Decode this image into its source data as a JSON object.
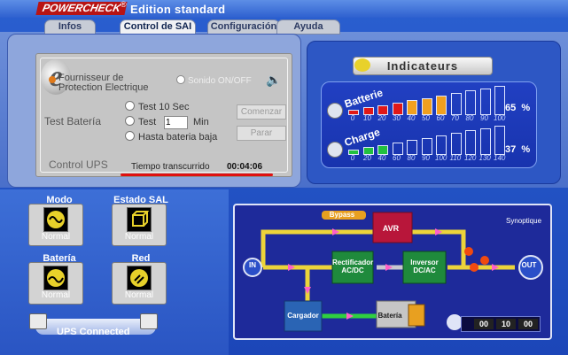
{
  "app": {
    "logo": "POWERCHECK",
    "reg": "®",
    "edition": "Edition standard"
  },
  "tabs": [
    {
      "label": "Infos"
    },
    {
      "label": "Control de SAI"
    },
    {
      "label": "Configuración"
    },
    {
      "label": "Ayuda"
    }
  ],
  "control": {
    "provider": "Fournisseur de Protection Electrique",
    "sonido": "Sonido ON/OFF",
    "test_heading": "Test Batería",
    "options": [
      "Test 10 Sec",
      "Test",
      "Hasta bateria baja"
    ],
    "minutes_value": "1",
    "minutes_label": "Min",
    "start_button": "Comenzar",
    "stop_button": "Parar",
    "section_label": "Control UPS",
    "elapsed_label": "Tiempo transcurrido",
    "elapsed_value": "00:04:06"
  },
  "indicators": {
    "title": "Indicateurs",
    "battery": {
      "label": "Batterie",
      "percent": "65",
      "unit": "%",
      "ticks": [
        "0",
        "10",
        "20",
        "30",
        "40",
        "50",
        "60",
        "70",
        "80",
        "90",
        "100"
      ],
      "fill_level": 65
    },
    "charge": {
      "label": "Charge",
      "percent": "37",
      "unit": "%",
      "ticks": [
        "0",
        "20",
        "40",
        "60",
        "80",
        "90",
        "100",
        "110",
        "120",
        "130",
        "140"
      ],
      "fill_level": 37
    }
  },
  "status": {
    "modo": {
      "title": "Modo",
      "state": "Normal",
      "icon": "ac-wave-icon"
    },
    "estado": {
      "title": "Estado SAL",
      "state": "Normal",
      "icon": "cube-icon"
    },
    "bateria": {
      "title": "Batería",
      "state": "Normal",
      "icon": "battery-wave-icon"
    },
    "red": {
      "title": "Red",
      "state": "Normal",
      "icon": "plug-icon"
    },
    "connection": "UPS Connected"
  },
  "synoptique": {
    "title": "Synoptique",
    "bypass": "Bypass",
    "avr": "AVR",
    "rectifier": "Rectificador AC/DC",
    "inverter": "Inversor DC/AC",
    "charger": "Cargador",
    "battery": "Batería",
    "in": "IN",
    "out": "OUT",
    "timer": [
      "00",
      "10",
      "00"
    ]
  },
  "colors": {
    "accent_red": "#e01010",
    "panel_blue": "#2140c2",
    "bar_red": "#e01818",
    "bar_orange": "#f0a020",
    "bar_green": "#22c040"
  }
}
